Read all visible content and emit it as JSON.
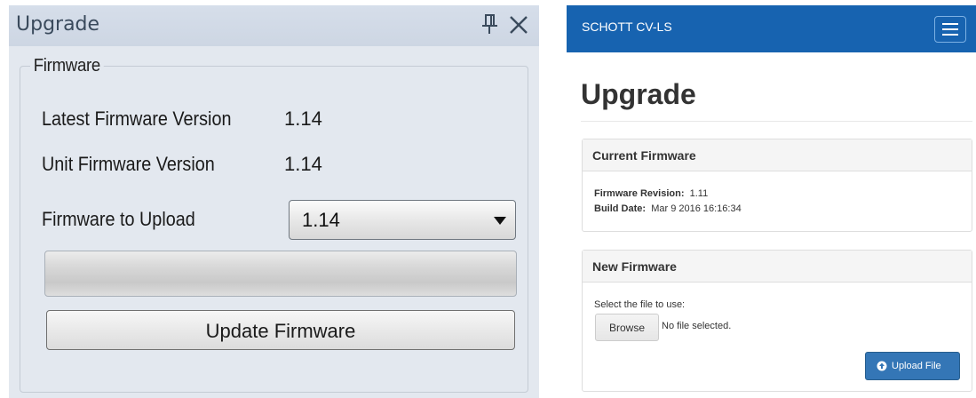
{
  "desktop_panel": {
    "title": "Upgrade",
    "icons": {
      "pin": "pin-icon",
      "close": "close-icon",
      "dropdown": "chevron-down-icon"
    },
    "group_label": "Firmware",
    "latest_label": "Latest Firmware Version",
    "latest_value": "1.14",
    "unit_label": "Unit Firmware Version",
    "unit_value": "1.14",
    "upload_label": "Firmware to Upload",
    "upload_selected": "1.14",
    "progress_fraction": 0,
    "update_button": "Update Firmware"
  },
  "web_app": {
    "brand": "SCHOTT CV-LS",
    "menu_icon": "menu-icon",
    "page_title": "Upgrade",
    "current_panel": {
      "title": "Current Firmware",
      "revision_label": "Firmware Revision:",
      "revision_value": "1.11",
      "build_label": "Build Date:",
      "build_value": "Mar 9 2016 16:16:34"
    },
    "new_panel": {
      "title": "New Firmware",
      "instruction": "Select the file to use:",
      "browse_button": "Browse",
      "file_status": "No file selected.",
      "upload_button": "Upload File",
      "upload_icon": "upload-circle-icon"
    },
    "colors": {
      "navbar": "#1763b0",
      "primary_button": "#3476b6"
    }
  }
}
